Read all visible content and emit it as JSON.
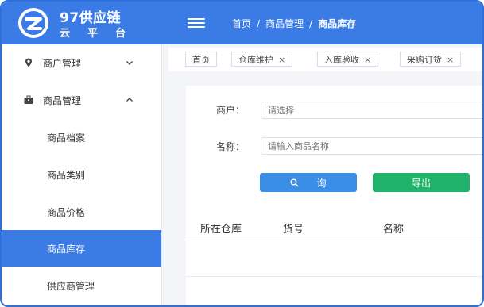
{
  "brand": {
    "name": "97供应链",
    "subtitle": "云平台"
  },
  "header": {
    "breadcrumb": [
      "首页",
      "商品管理",
      "商品库存"
    ],
    "separator": "/"
  },
  "sidebar": {
    "items": [
      {
        "label": "商户管理",
        "icon": "location-pin-icon",
        "expanded": false
      },
      {
        "label": "商品管理",
        "icon": "briefcase-icon",
        "expanded": true
      },
      {
        "label": "商品档案"
      },
      {
        "label": "商品类别"
      },
      {
        "label": "商品价格"
      },
      {
        "label": "商品库存",
        "active": true
      },
      {
        "label": "供应商管理"
      }
    ]
  },
  "tabs": [
    {
      "label": "首页",
      "closable": false
    },
    {
      "label": "仓库维护",
      "closable": true
    },
    {
      "label": "入库验收",
      "closable": true
    },
    {
      "label": "采购订货",
      "closable": true
    }
  ],
  "tab_close_glyph": "×",
  "form": {
    "merchant": {
      "label": "商户：",
      "placeholder": "请选择"
    },
    "name": {
      "label": "名称：",
      "placeholder": "请输入商品名称"
    },
    "query_label": "询",
    "export_label": "导出"
  },
  "table": {
    "headers": [
      "所在仓库",
      "货号",
      "名称"
    ]
  },
  "colors": {
    "primary": "#3a7be6",
    "query": "#3a8ee6",
    "export": "#1fb36b",
    "frame": "#2f6fdc"
  }
}
